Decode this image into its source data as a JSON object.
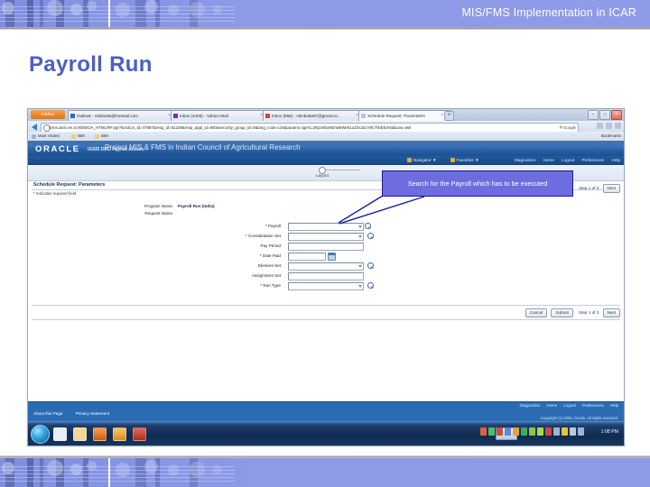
{
  "slide": {
    "header_title": "MIS/FMS Implementation in ICAR",
    "page_title": "Payroll Run"
  },
  "annotation": {
    "text": "Search for the Payroll which has to be executed",
    "fill_color": "#6d6de0",
    "border_color": "#1b1b8f"
  },
  "browser": {
    "firefox_button": "Firefox",
    "tabs": [
      {
        "label": "Outlook - nitinbatta@hotmail.com",
        "active": false
      },
      {
        "label": "Inbox (4406) - Yahoo! Mail",
        "active": false
      },
      {
        "label": "Inbox (866) - nitinbatta07@gmail.co...",
        "active": false
      },
      {
        "label": "Schedule Request: Parameters",
        "active": true
      }
    ],
    "new_tab_label": "+",
    "window_buttons": [
      "–",
      "□",
      "×"
    ],
    "url": "hrms.iasri.res.in:8005/OA_HTML/RF.jsp?function_id=47887&resp_id=51238&resp_appl_id=800&security_group_id=0&lang_code=US&params=IgeXL1Rj1MDoNEhw5We61oZXUd1iY9c7f4IEEXNd&oas=aW",
    "url_search_provider": "Google",
    "bookmarks": [
      "Most Visited",
      "IBM",
      "IBM"
    ],
    "bookmarks_right_label": "Bookmarks"
  },
  "oracle": {
    "logo": "ORACLE",
    "logo_subtitle": "IASRI DDO Payroll Access",
    "overlay_banner": "Project MIS & FMS in Indian Council of Agricultural Research",
    "global_menus": [
      "Navigator",
      "Favorites"
    ],
    "global_links": [
      "Diagnostics",
      "Home",
      "Logout",
      "Preferences",
      "Help"
    ],
    "train_step_label": "Layout",
    "page_heading": "Schedule Request: Parameters",
    "required_note": "* Indicates required field",
    "program_name_label": "Program Name",
    "program_name_value": "Payroll Run (India)",
    "request_name_label": "Request Name",
    "fields": [
      {
        "label": "* Payroll",
        "required": true,
        "dropdown": true,
        "lov": true,
        "calendar": false
      },
      {
        "label": "* Consolidation Set",
        "required": true,
        "dropdown": true,
        "lov": true,
        "calendar": false
      },
      {
        "label": "Pay Period",
        "required": false,
        "dropdown": false,
        "lov": false,
        "calendar": false
      },
      {
        "label": "* Date Paid",
        "required": true,
        "dropdown": false,
        "lov": false,
        "calendar": true
      },
      {
        "label": "Element Set",
        "required": false,
        "dropdown": true,
        "lov": true,
        "calendar": false
      },
      {
        "label": "Assignment Set",
        "required": false,
        "dropdown": false,
        "lov": false,
        "calendar": false
      },
      {
        "label": "* Run Type",
        "required": true,
        "dropdown": true,
        "lov": true,
        "calendar": false
      }
    ],
    "buttons": {
      "cancel": "Cancel",
      "submit": "Submit",
      "next": "Next",
      "step": "Step 1 of 3"
    },
    "footer_links_right": [
      "Diagnostics",
      "Home",
      "Logout",
      "Preferences",
      "Help"
    ],
    "footer_links_left": [
      "About this Page",
      "Privacy Statement"
    ],
    "copyright": "Copyright (c) 2006, Oracle. All rights reserved."
  },
  "taskbar": {
    "start_label": "Start",
    "clock": "1:08 PM"
  }
}
